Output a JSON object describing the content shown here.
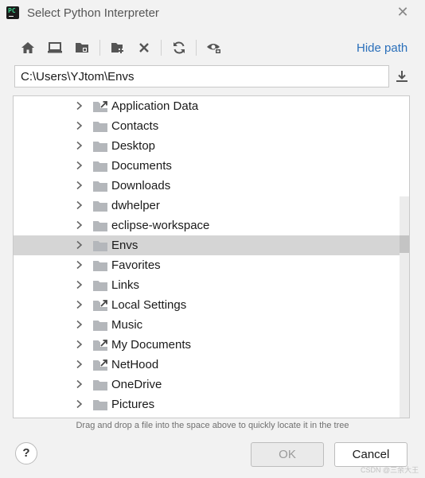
{
  "window": {
    "title": "Select Python Interpreter",
    "app_icon": "pycharm-logo",
    "app_icon_text": "PC"
  },
  "toolbar": {
    "buttons": [
      {
        "name": "home-icon"
      },
      {
        "name": "desktop-icon"
      },
      {
        "name": "project-folder-icon"
      },
      {
        "name": "new-folder-icon"
      },
      {
        "name": "delete-icon"
      },
      {
        "name": "refresh-icon"
      },
      {
        "name": "show-hidden-icon"
      }
    ],
    "hide_path_label": "Hide path"
  },
  "path": {
    "value": "C:\\Users\\YJtom\\Envs"
  },
  "tree": {
    "items": [
      {
        "label": "Application Data",
        "link": true,
        "selected": false
      },
      {
        "label": "Contacts",
        "link": false,
        "selected": false
      },
      {
        "label": "Desktop",
        "link": false,
        "selected": false
      },
      {
        "label": "Documents",
        "link": false,
        "selected": false
      },
      {
        "label": "Downloads",
        "link": false,
        "selected": false
      },
      {
        "label": "dwhelper",
        "link": false,
        "selected": false
      },
      {
        "label": "eclipse-workspace",
        "link": false,
        "selected": false
      },
      {
        "label": "Envs",
        "link": false,
        "selected": true
      },
      {
        "label": "Favorites",
        "link": false,
        "selected": false
      },
      {
        "label": "Links",
        "link": false,
        "selected": false
      },
      {
        "label": "Local Settings",
        "link": true,
        "selected": false
      },
      {
        "label": "Music",
        "link": false,
        "selected": false
      },
      {
        "label": "My Documents",
        "link": true,
        "selected": false
      },
      {
        "label": "NetHood",
        "link": true,
        "selected": false
      },
      {
        "label": "OneDrive",
        "link": false,
        "selected": false
      },
      {
        "label": "Pictures",
        "link": false,
        "selected": false
      }
    ]
  },
  "hint": "Drag and drop a file into the space above to quickly locate it in the tree",
  "buttons": {
    "help": "?",
    "ok": "OK",
    "cancel": "Cancel"
  },
  "watermark": "CSDN @三余大王",
  "colors": {
    "accent_link": "#2a6fba",
    "selection": "#d5d5d5",
    "folder": "#b4b7bb"
  }
}
